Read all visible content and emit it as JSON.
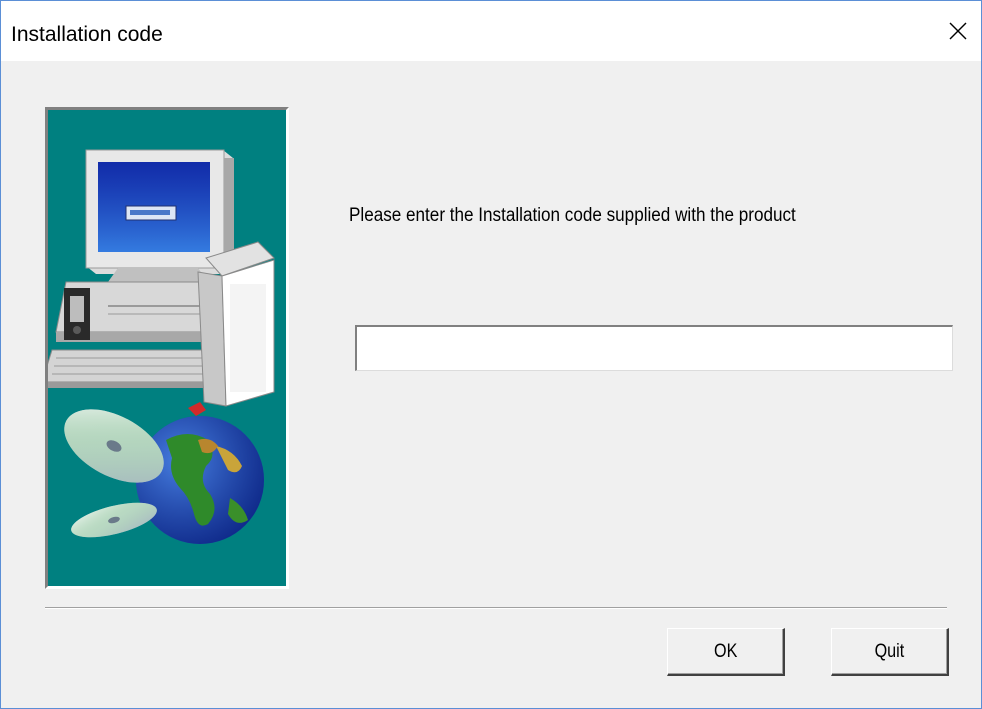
{
  "window": {
    "title": "Installation code",
    "close_icon": "close-icon"
  },
  "art": {
    "icon": "computer-cd-globe-illustration",
    "background_color": "#008080"
  },
  "form": {
    "prompt": "Please enter the Installation code supplied with the product",
    "code_value": "",
    "code_placeholder": ""
  },
  "buttons": {
    "ok_label": "OK",
    "quit_label": "Quit"
  }
}
